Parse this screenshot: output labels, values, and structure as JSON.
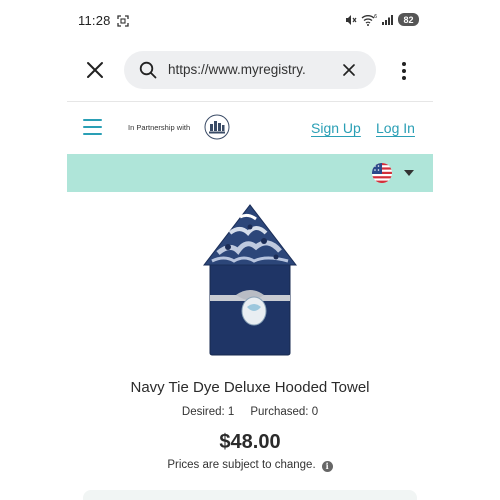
{
  "status_bar": {
    "time": "11:28",
    "battery": "82",
    "icons": [
      "screenshot-icon",
      "mute-icon",
      "wifi-icon",
      "signal-icon",
      "battery-icon"
    ]
  },
  "browser": {
    "url": "https://www.myregistry.",
    "icons": [
      "close-icon",
      "search-icon",
      "clear-icon",
      "more-vert-icon"
    ]
  },
  "site_header": {
    "partner_text": "In Partnership with",
    "sign_up": "Sign Up",
    "log_in": "Log In",
    "accent_color": "#2a9fb5"
  },
  "country_bar": {
    "background": "#afe5d9",
    "flag": "us-flag-icon"
  },
  "product": {
    "title": "Navy Tie Dye Deluxe Hooded Towel",
    "desired": "Desired: 1",
    "purchased": "Purchased: 0",
    "price": "$48.00",
    "price_note": "Prices are subject to change."
  }
}
